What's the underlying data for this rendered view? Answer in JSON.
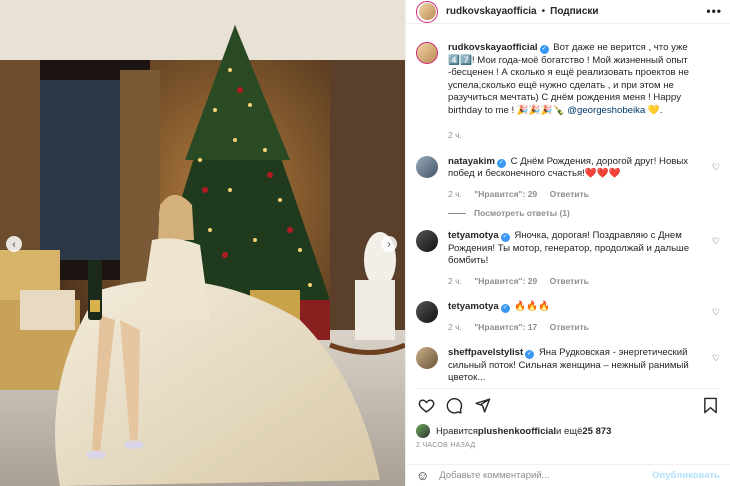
{
  "header": {
    "username": "rudkovskayaofficia",
    "separator": "•",
    "follow_label": "Подписки",
    "more": "•••"
  },
  "caption": {
    "username": "rudkovskayaofficial",
    "text": "Вот даже не верится , что уже 4️⃣7️⃣! Мои года-моё богатство ! Мой жизненный опыт -бесценен ! А сколько я ещё реализовать проектов не успела,сколько ещё нужно сделать , и при этом не разучиться мечтать) С днём рождения меня ! Happy birthday to me ! 🎉🎉🎉🍾",
    "mention": "@georgeshobeika",
    "mention_tail": " 💛.",
    "time": "2 ч."
  },
  "comments": [
    {
      "username": "natayakim",
      "text": "С Днём Рождения, дорогой друг! Новых побед и бесконечного счастья!❤️❤️❤️",
      "time": "2 ч.",
      "likes": "\"Нравится\": 29",
      "reply": "Ответить",
      "view_replies": "Посмотреть ответы (1)"
    },
    {
      "username": "tetyamotya",
      "text": "Яночка, дорогая! Поздравляю с Днем Рождения! Ты мотор, генератор, продолжай и дальше бомбить!",
      "time": "2 ч.",
      "likes": "\"Нравится\": 29",
      "reply": "Ответить"
    },
    {
      "username": "tetyamotya",
      "text": "🔥🔥🔥",
      "time": "2 ч.",
      "likes": "\"Нравится\": 17",
      "reply": "Ответить"
    },
    {
      "username": "sheffpavelstylist",
      "text": "Яна Рудковская - энергетический сильный поток! Сильная женщина – нежный ранимый цветок..."
    }
  ],
  "likes": {
    "prefix": "Нравится ",
    "user": "plushenkoofficial",
    "middle": " и ещё ",
    "count": "25 873"
  },
  "time_ago": "2 ЧАСОВ НАЗАД",
  "comment_box": {
    "placeholder": "Добавьте комментарий...",
    "post_label": "Опубликовать"
  },
  "colors": {
    "accent": "#3897f0",
    "muted": "#8e8e8e",
    "post_disabled": "#b2dffc"
  }
}
